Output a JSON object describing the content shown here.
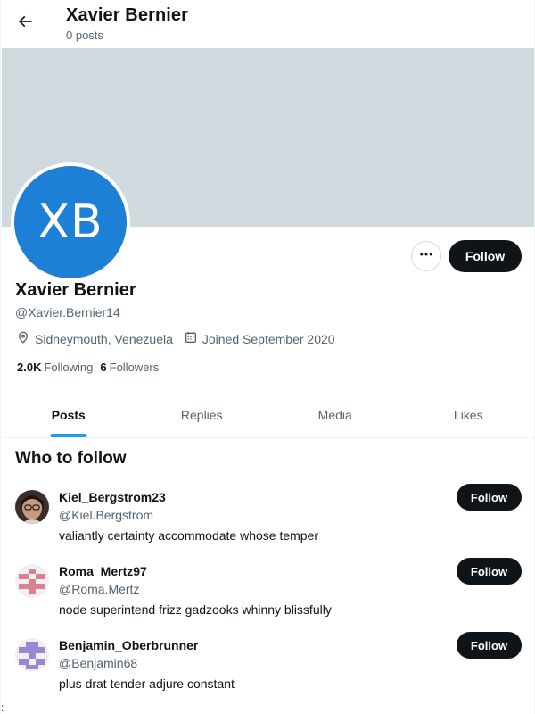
{
  "header": {
    "title": "Xavier Bernier",
    "subtitle": "0 posts"
  },
  "profile": {
    "avatar_initials": "XB",
    "avatar_color": "#1d7fd6",
    "name": "Xavier Bernier",
    "handle": "@Xavier.Bernier14",
    "location": "Sidneymouth, Venezuela",
    "joined": "Joined September 2020",
    "following_count": "2.0K",
    "following_label": "Following",
    "followers_count": "6",
    "followers_label": "Followers",
    "follow_label": "Follow"
  },
  "tabs": [
    {
      "label": "Posts",
      "active": true
    },
    {
      "label": "Replies",
      "active": false
    },
    {
      "label": "Media",
      "active": false
    },
    {
      "label": "Likes",
      "active": false
    }
  ],
  "who_to_follow": {
    "title": "Who to follow",
    "items": [
      {
        "name": "Kiel_Bergstrom23",
        "handle": "@Kiel.Bergstrom",
        "bio": "valiantly certainty accommodate whose temper",
        "follow_label": "Follow",
        "avatar": "photo"
      },
      {
        "name": "Roma_Mertz97",
        "handle": "@Roma.Mertz",
        "bio": "node superintend frizz gadzooks whinny blissfully",
        "follow_label": "Follow",
        "avatar": "identicon-pink"
      },
      {
        "name": "Benjamin_Oberbrunner",
        "handle": "@Benjamin68",
        "bio": "plus drat tender adjure constant",
        "follow_label": "Follow",
        "avatar": "identicon-purple"
      }
    ]
  },
  "stray_char": ":",
  "colors": {
    "accent": "#1d9bf0",
    "button_dark": "#0f1419",
    "banner": "#cfd9de",
    "secondary_text": "#536471"
  }
}
